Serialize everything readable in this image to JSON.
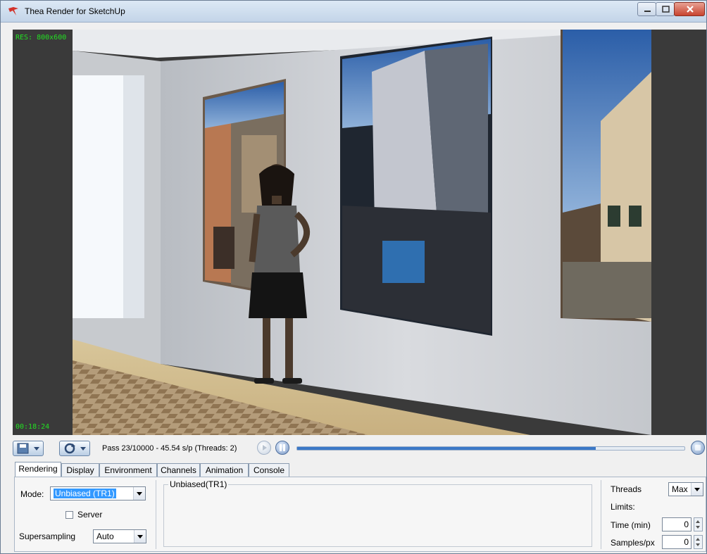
{
  "window": {
    "title": "Thea Render for SketchUp"
  },
  "viewport": {
    "resolution_label": "RES: 800x600",
    "elapsed_time": "00:18:24"
  },
  "controls": {
    "status": "Pass 23/10000 - 45.54 s/p (Threads: 2)",
    "progress_fraction": 0.77
  },
  "tabs": [
    {
      "label": "Rendering",
      "active": true
    },
    {
      "label": "Display",
      "active": false
    },
    {
      "label": "Environment",
      "active": false
    },
    {
      "label": "Channels",
      "active": false
    },
    {
      "label": "Animation",
      "active": false
    },
    {
      "label": "Console",
      "active": false
    }
  ],
  "rendering": {
    "mode_label": "Mode:",
    "mode_value": "Unbiased (TR1)",
    "server_label": "Server",
    "server_checked": false,
    "supersampling_label": "Supersampling",
    "supersampling_value": "Auto",
    "group_title": "Unbiased(TR1)",
    "threads_label": "Threads",
    "threads_value": "Max",
    "limits_label": "Limits:",
    "time_label": "Time (min)",
    "time_value": "0",
    "samples_label": "Samples/px",
    "samples_value": "0"
  },
  "colors": {
    "overlay_text": "#22e022",
    "selection": "#3399ff",
    "progress_fill": "#3b78c7"
  },
  "icons": {
    "app": "thea-logo-icon",
    "save": "save-render-icon",
    "refresh": "refresh-render-icon",
    "play": "play-icon",
    "pause": "pause-icon",
    "stop": "stop-icon"
  }
}
